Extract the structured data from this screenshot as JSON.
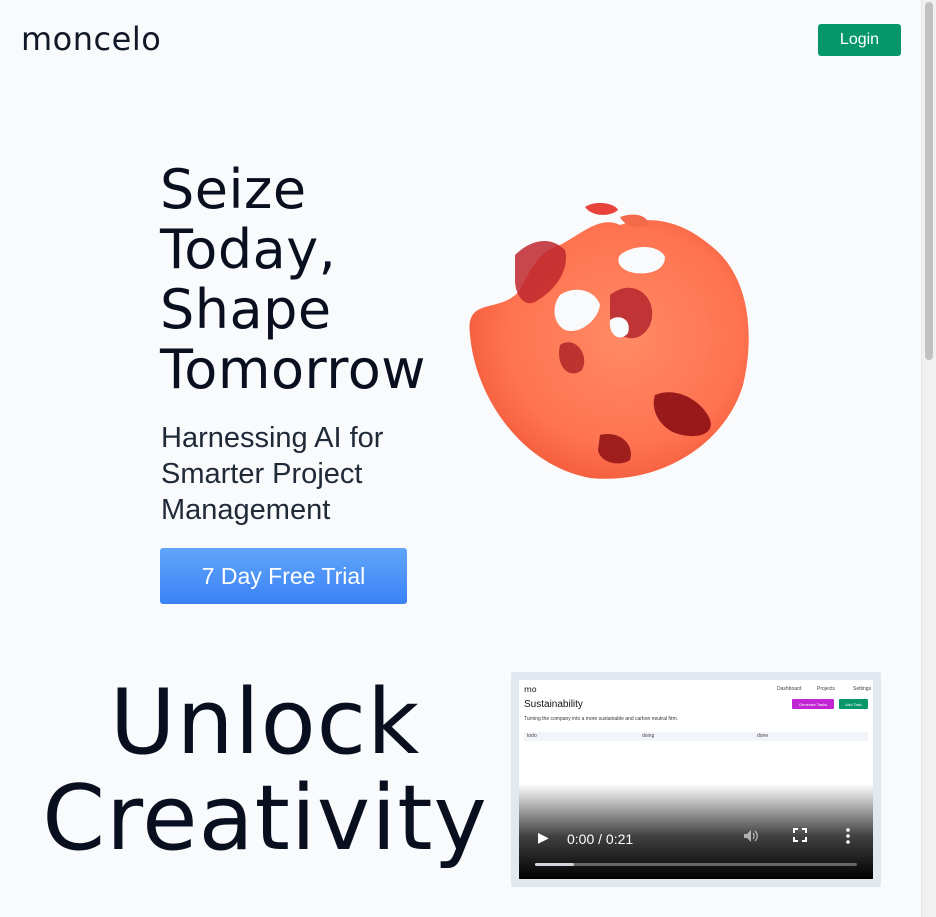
{
  "header": {
    "brand": "moncelo",
    "login_label": "Login"
  },
  "hero": {
    "title_lines": [
      "Seize",
      "Today,",
      "Shape",
      "Tomorrow"
    ],
    "subtitle_lines": [
      "Harnessing AI for",
      "Smarter Project",
      "Management"
    ],
    "cta_label": "7 Day Free Trial"
  },
  "section2": {
    "title_lines": [
      "Unlock",
      "Creativity"
    ]
  },
  "video": {
    "preview": {
      "logo": "mo",
      "nav": [
        "Dashboard",
        "Projects",
        "Settings"
      ],
      "title": "Sustainability",
      "description": "Turning the company into a more sustainable and carbon neutral firm.",
      "button_generate": "Generate Tasks",
      "button_add": "Add Task",
      "columns": [
        "todo",
        "doing",
        "done"
      ]
    },
    "time": "0:00 / 0:21",
    "progress": 0.12
  },
  "colors": {
    "login": "#059669",
    "cta": "#3b82f6",
    "background": "#f8fafc",
    "blob": "#ff7a55"
  }
}
